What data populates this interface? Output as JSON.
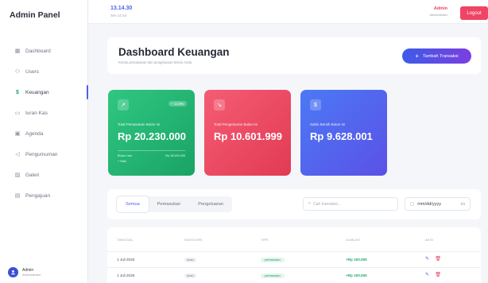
{
  "brand": "Admin Panel",
  "sidebar": {
    "items": [
      {
        "label": "Dashboard",
        "icon": "grid-icon"
      },
      {
        "label": "Users",
        "icon": "users-icon"
      },
      {
        "label": "Keuangan",
        "icon": "dollar-icon"
      },
      {
        "label": "Iuran Kas",
        "icon": "cash-icon"
      },
      {
        "label": "Agenda",
        "icon": "calendar-icon"
      },
      {
        "label": "Pengumuman",
        "icon": "megaphone-icon"
      },
      {
        "label": "Galeri",
        "icon": "image-icon"
      },
      {
        "label": "Pengajuan",
        "icon": "document-icon"
      }
    ],
    "active_index": 2,
    "user": {
      "name": "Admin",
      "role": "Administrator"
    }
  },
  "topbar": {
    "time": "13.14.30",
    "date": "Sen 14 Jul",
    "admin_name": "Admin",
    "admin_role": "Administrator",
    "logout_label": "Logout"
  },
  "header": {
    "title": "Dashboard Keuangan",
    "subtitle": "Kelola pemasukan dan pengeluaran bisnis Anda",
    "add_button_label": "Tambah Transaksi"
  },
  "stats": {
    "income": {
      "label": "Total Pemasukan Bulan Ini",
      "value": "Rp 20.230.000",
      "badge": "+ 12.5%",
      "foot_left": "Bulan Lalu",
      "foot_right": "Rp 18.000.000",
      "foot_left2": "+ Naik"
    },
    "expense": {
      "label": "Total Pengeluaran Bulan Ini",
      "value": "Rp 10.601.999"
    },
    "balance": {
      "label": "Saldo Bersih Bulan Ini",
      "value": "Rp 9.628.001"
    }
  },
  "filters": {
    "tabs": [
      "Semua",
      "Pemasukan",
      "Pengeluaran"
    ],
    "active_tab": 0,
    "search_placeholder": "Cari transaksi...",
    "date_placeholder": "mm/dd/yyyy"
  },
  "table": {
    "headers": [
      "TANGGAL",
      "KATEGORI",
      "TIPE",
      "JUMLAH",
      "AKSI"
    ],
    "rows": [
      {
        "date": "1 Juli 2025",
        "category": "Iuran",
        "type": "pemasukan",
        "amount": "+Rp 100.000"
      },
      {
        "date": "1 Juli 2025",
        "category": "Iuran",
        "type": "pemasukan",
        "amount": "+Rp 100.000"
      }
    ]
  },
  "colors": {
    "accent": "#4b62e8",
    "income": "#22b573",
    "expense": "#ee4a63",
    "balance": "#5068ee",
    "logout": "#ef4463"
  }
}
